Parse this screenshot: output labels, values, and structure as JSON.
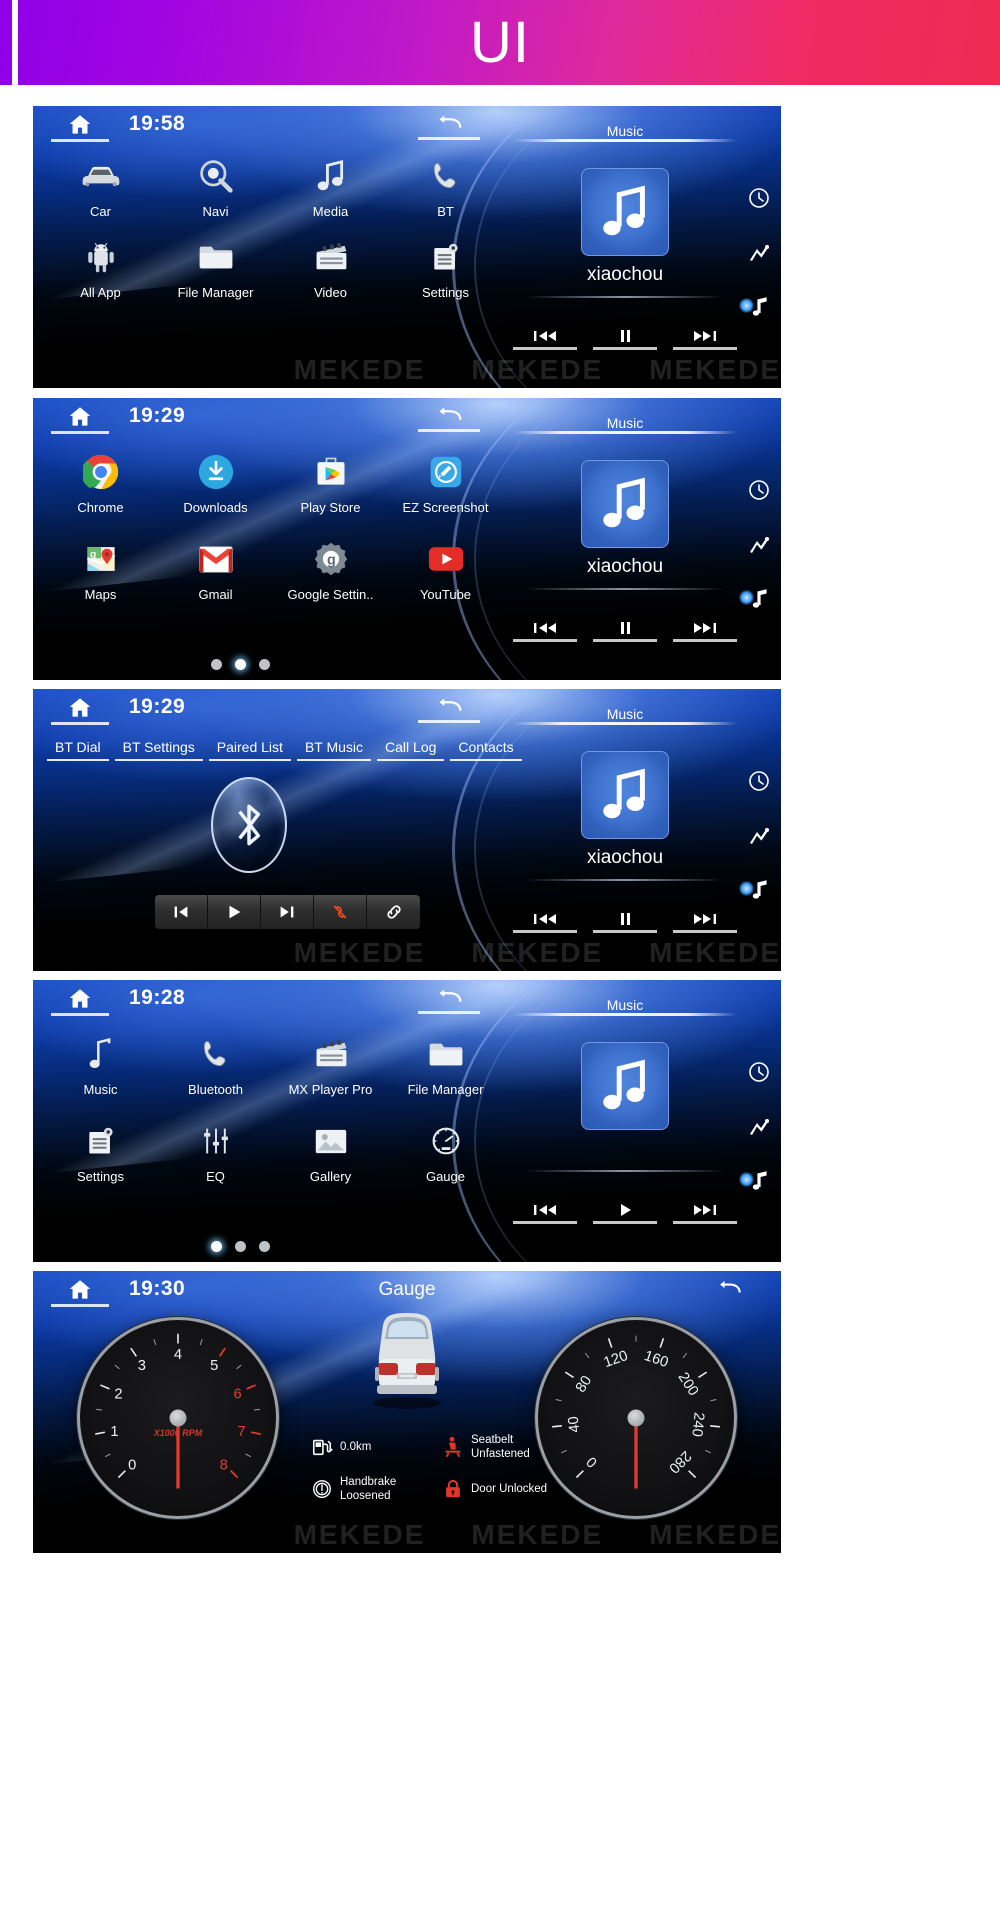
{
  "header": {
    "title": "UI",
    "gradient_from": "#8f00e8",
    "gradient_to": "#ef2b52"
  },
  "watermark": {
    "text": "MEKEDE"
  },
  "panels": [
    {
      "id": "home",
      "clock": "19:58",
      "home_icon": "home-icon",
      "back_icon": "back-arrow-icon",
      "apps": [
        {
          "label": "Car",
          "icon": "car-icon"
        },
        {
          "label": "Navi",
          "icon": "navigation-icon"
        },
        {
          "label": "Media",
          "icon": "music-note-icon"
        },
        {
          "label": "BT",
          "icon": "phone-icon"
        },
        {
          "label": "All App",
          "icon": "android-icon"
        },
        {
          "label": "File Manager",
          "icon": "folder-icon"
        },
        {
          "label": "Video",
          "icon": "video-icon"
        },
        {
          "label": "Settings",
          "icon": "settings-list-icon"
        }
      ],
      "music": {
        "title": "Music",
        "track": "xiaochou",
        "art_icon": "music-note-icon",
        "controls": [
          {
            "name": "previous",
            "icon": "prev-track-icon"
          },
          {
            "name": "pause",
            "icon": "pause-icon"
          },
          {
            "name": "next",
            "icon": "next-track-icon"
          }
        ]
      },
      "rail": [
        {
          "name": "clock-rail-icon"
        },
        {
          "name": "shuffle-rail-icon"
        },
        {
          "name": "music-rail-icon"
        }
      ],
      "dots": null
    },
    {
      "id": "all-apps",
      "clock": "19:29",
      "home_icon": "home-icon",
      "back_icon": "back-arrow-icon",
      "apps": [
        {
          "label": "Chrome",
          "icon": "chrome-icon"
        },
        {
          "label": "Downloads",
          "icon": "downloads-icon"
        },
        {
          "label": "Play Store",
          "icon": "play-store-icon"
        },
        {
          "label": "EZ Screenshot",
          "icon": "ez-screenshot-icon"
        },
        {
          "label": "Maps",
          "icon": "maps-icon"
        },
        {
          "label": "Gmail",
          "icon": "gmail-icon"
        },
        {
          "label": "Google Settin..",
          "icon": "google-settings-icon"
        },
        {
          "label": "YouTube",
          "icon": "youtube-icon"
        }
      ],
      "music": {
        "title": "Music",
        "track": "xiaochou",
        "art_icon": "music-note-icon",
        "controls": [
          {
            "name": "previous",
            "icon": "prev-track-icon"
          },
          {
            "name": "pause",
            "icon": "pause-icon"
          },
          {
            "name": "next",
            "icon": "next-track-icon"
          }
        ]
      },
      "rail": [
        {
          "name": "clock-rail-icon"
        },
        {
          "name": "shuffle-rail-icon"
        },
        {
          "name": "music-rail-icon"
        }
      ],
      "dots": {
        "count": 3,
        "active": 1
      }
    },
    {
      "id": "bluetooth",
      "clock": "19:29",
      "home_icon": "home-icon",
      "back_icon": "back-arrow-icon",
      "tabs": [
        "BT Dial",
        "BT Settings",
        "Paired List",
        "BT Music",
        "Call Log",
        "Contacts"
      ],
      "bt_logo_icon": "bluetooth-icon",
      "bt_buttons": [
        {
          "name": "previous",
          "icon": "prev-track-icon",
          "color": "#ffffff"
        },
        {
          "name": "play",
          "icon": "play-icon",
          "color": "#ffffff"
        },
        {
          "name": "next",
          "icon": "next-track-icon",
          "color": "#ffffff"
        },
        {
          "name": "disconnect",
          "icon": "hangup-icon",
          "color": "#f04a1e"
        },
        {
          "name": "connect",
          "icon": "link-icon",
          "color": "#ffffff"
        }
      ],
      "music": {
        "title": "Music",
        "track": "xiaochou",
        "art_icon": "music-note-icon",
        "controls": [
          {
            "name": "previous",
            "icon": "prev-track-icon"
          },
          {
            "name": "pause",
            "icon": "pause-icon"
          },
          {
            "name": "next",
            "icon": "next-track-icon"
          }
        ]
      },
      "rail": [
        {
          "name": "clock-rail-icon"
        },
        {
          "name": "shuffle-rail-icon"
        },
        {
          "name": "music-rail-icon"
        }
      ],
      "dots": null
    },
    {
      "id": "media",
      "clock": "19:28",
      "home_icon": "home-icon",
      "back_icon": "back-arrow-icon",
      "apps": [
        {
          "label": "Music",
          "icon": "music-note-icon"
        },
        {
          "label": "Bluetooth",
          "icon": "phone-icon"
        },
        {
          "label": "MX Player Pro",
          "icon": "video-icon"
        },
        {
          "label": "File Manager",
          "icon": "folder-icon"
        },
        {
          "label": "Settings",
          "icon": "settings-list-icon"
        },
        {
          "label": "EQ",
          "icon": "equalizer-icon"
        },
        {
          "label": "Gallery",
          "icon": "gallery-icon"
        },
        {
          "label": "Gauge",
          "icon": "gauge-icon"
        }
      ],
      "music": {
        "title": "Music",
        "track": "",
        "art_icon": "music-note-icon",
        "controls": [
          {
            "name": "previous",
            "icon": "prev-track-icon"
          },
          {
            "name": "play",
            "icon": "play-icon"
          },
          {
            "name": "next",
            "icon": "next-track-icon"
          }
        ]
      },
      "rail": [
        {
          "name": "clock-rail-icon"
        },
        {
          "name": "shuffle-rail-icon"
        },
        {
          "name": "music-rail-icon"
        }
      ],
      "dots": {
        "count": 3,
        "active": 0
      }
    },
    {
      "id": "gauge",
      "clock": "19:30",
      "home_icon": "home-icon",
      "back_icon": "back-arrow-icon",
      "title": "Gauge",
      "tachometer": {
        "unit": "X1000 RPM",
        "ticks": [
          0,
          1,
          2,
          3,
          4,
          5,
          6,
          7,
          8
        ],
        "redline_from": 6,
        "value": 0,
        "needle_color": "#e02b22"
      },
      "speedometer": {
        "unit": "",
        "ticks": [
          0,
          40,
          80,
          120,
          160,
          200,
          240,
          280
        ],
        "value": 0,
        "needle_color": "#e02b22"
      },
      "car_icon": "car-rear-icon",
      "indicators": [
        {
          "label": "0.0km",
          "icon": "fuel-range-icon",
          "color": "#ffffff"
        },
        {
          "label": "Seatbelt\nUnfastened",
          "icon": "seatbelt-icon",
          "color": "#e4352b"
        },
        {
          "label": "Handbrake\nLoosened",
          "icon": "handbrake-icon",
          "color": "#ffffff"
        },
        {
          "label": "Door Unlocked",
          "icon": "door-lock-icon",
          "color": "#e4352b"
        }
      ],
      "dots": null
    }
  ]
}
